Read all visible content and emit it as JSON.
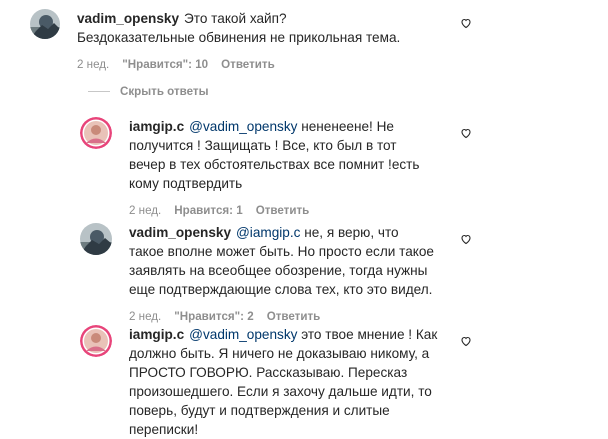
{
  "comments": [
    {
      "username": "vadim_opensky",
      "mention": "",
      "text": "Это такой хайп? Бездоказательные обвинения не прикольная тема.",
      "time": "2 нед.",
      "likes": "\"Нравится\": 10",
      "reply": "Ответить"
    },
    {
      "username": "iamgip.c",
      "mention": "@vadim_opensky",
      "text": "нененеене! Не получится ! Защищать ! Все, кто был в тот вечер в тех обстоятельствах все помнит !есть кому подтвердить",
      "time": "2 нед.",
      "likes": "Нравится: 1",
      "reply": "Ответить"
    },
    {
      "username": "vadim_opensky",
      "mention": "@iamgip.c",
      "text": "не, я верю, что такое вполне может быть. Но просто если такое заявлять на всеобщее обозрение, тогда нужны еще подтверждающие слова тех, кто это видел.",
      "time": "2 нед.",
      "likes": "\"Нравится\": 2",
      "reply": "Ответить"
    },
    {
      "username": "iamgip.c",
      "mention": "@vadim_opensky",
      "text": "это твое мнение ! Как должно быть. Я ничего не доказываю никому, а ПРОСТО ГОВОРЮ. Рассказываю. Пересказ произошедшего. Если я захочу дальше идти, то поверь, будут и подтверждения и слитые переписки!",
      "time": "",
      "likes": "",
      "reply": ""
    }
  ],
  "hide_replies_label": "Скрыть ответы",
  "icons": {
    "like": "heart-outline-icon"
  },
  "colors": {
    "text": "#262626",
    "secondary": "#8e8e8e",
    "mention": "#00376b"
  }
}
